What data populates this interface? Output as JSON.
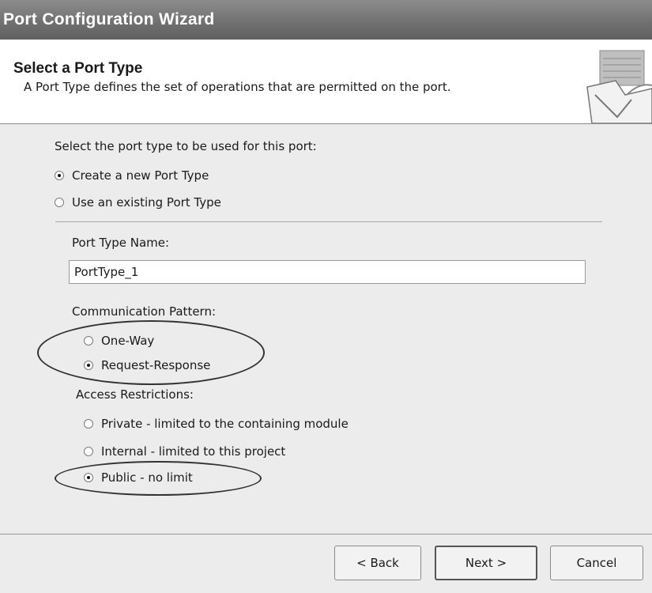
{
  "window": {
    "title": "Port Configuration Wizard"
  },
  "header": {
    "title": "Select a Port Type",
    "subtitle": "A Port Type defines the set of operations that are permitted on the port.",
    "icon": "wizard-port-icon"
  },
  "prompt": "Select the port type to be used for this port:",
  "port_type_options": [
    {
      "label": "Create a new Port Type",
      "selected": true
    },
    {
      "label": "Use an existing Port Type",
      "selected": false
    }
  ],
  "port_type_name": {
    "label": "Port Type Name:",
    "value": "PortType_1"
  },
  "communication_pattern": {
    "label": "Communication Pattern:",
    "options": [
      {
        "label": "One-Way",
        "selected": false
      },
      {
        "label": "Request-Response",
        "selected": true
      }
    ]
  },
  "access_restrictions": {
    "label": "Access Restrictions:",
    "options": [
      {
        "label": "Private - limited to the containing module",
        "selected": false
      },
      {
        "label": "Internal - limited to this project",
        "selected": false
      },
      {
        "label": "Public - no limit",
        "selected": true
      }
    ]
  },
  "buttons": {
    "back": "< Back",
    "next": "Next >",
    "cancel": "Cancel"
  }
}
